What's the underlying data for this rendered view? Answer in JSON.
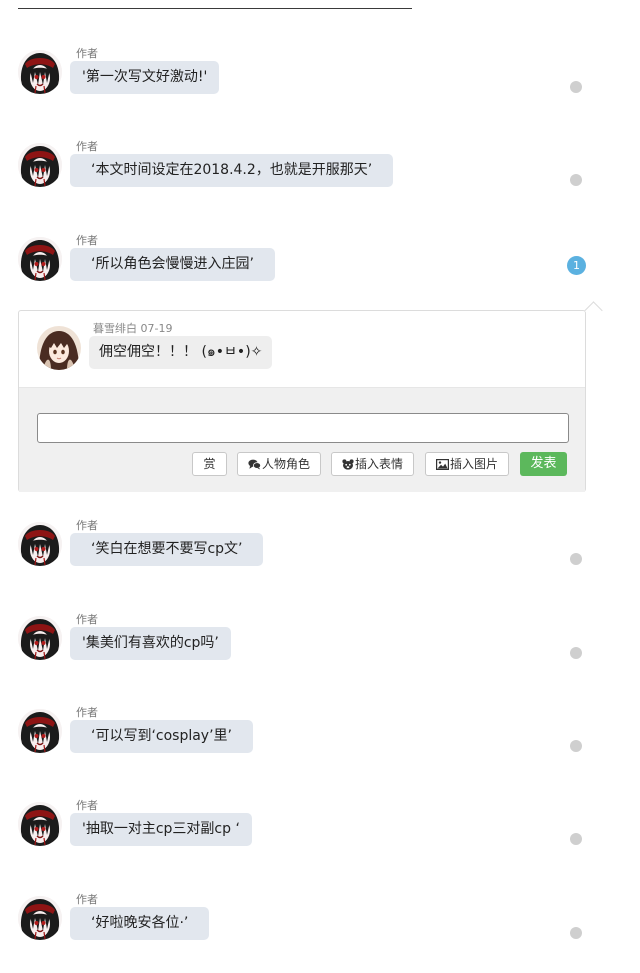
{
  "threads": [
    {
      "author": "作者",
      "text": "'第一次写文好激动!'"
    },
    {
      "author": "作者",
      "text": "‘本文时间设定在2018.4.2，也就是开服那天’"
    },
    {
      "author": "作者",
      "text": "‘所以角色会慢慢进入庄园’",
      "reply_count": "1"
    },
    {
      "author": "作者",
      "text": "‘笑白在想要不要写cp文’"
    },
    {
      "author": "作者",
      "text": "'集美们有喜欢的cp吗’"
    },
    {
      "author": "作者",
      "text": "‘可以写到‘cosplay’里’"
    },
    {
      "author": "作者",
      "text": "'抽取一对主cp三对副cp ‘"
    },
    {
      "author": "作者",
      "text": "‘好啦晚安各位·’"
    }
  ],
  "reply": {
    "user": "暮雪绯白",
    "date": "07-19",
    "text": "佣空佣空！！！ (๑•ㅂ•)✧"
  },
  "composer": {
    "input_value": "",
    "reward_label": "赏",
    "character_label": "人物角色",
    "emoji_label": "插入表情",
    "image_label": "插入图片",
    "publish_label": "发表"
  },
  "icons": {
    "character": "chat-bubbles-icon",
    "emoji": "bear-face-icon",
    "image": "picture-icon"
  },
  "colors": {
    "bubble": "#e2e7ee",
    "reply_badge": "#5bb1e0",
    "publish": "#5cb85c",
    "dot": "#cfcfcf"
  }
}
